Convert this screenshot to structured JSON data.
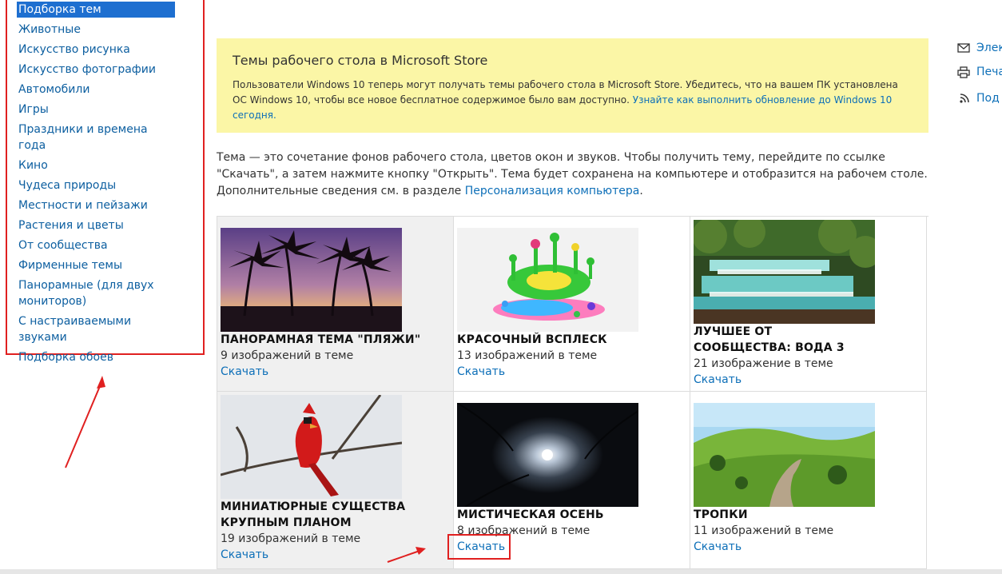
{
  "sidebar": {
    "items": [
      {
        "label": "Подборка тем",
        "active": true
      },
      {
        "label": "Животные"
      },
      {
        "label": "Искусство рисунка"
      },
      {
        "label": "Искусство фотографии"
      },
      {
        "label": "Автомобили"
      },
      {
        "label": "Игры"
      },
      {
        "label": "Праздники и времена года"
      },
      {
        "label": "Кино"
      },
      {
        "label": "Чудеса природы"
      },
      {
        "label": "Местности и пейзажи"
      },
      {
        "label": "Растения и цветы"
      },
      {
        "label": "От сообщества"
      },
      {
        "label": "Фирменные темы"
      },
      {
        "label": "Панорамные (для двух мониторов)"
      },
      {
        "label": "С настраиваемыми звуками"
      },
      {
        "label": "Подборка обоев"
      }
    ]
  },
  "banner": {
    "title": "Темы рабочего стола в Microsoft Store",
    "text": "Пользователи Windows 10 теперь могут получать темы рабочего стола в Microsoft Store. Убедитесь, что на вашем ПК установлена ОС Windows 10, чтобы все новое бесплатное содержимое было вам доступно.",
    "link": "Узнайте как выполнить обновление до Windows 10 сегодня."
  },
  "intro": {
    "text": "Тема — это сочетание фонов рабочего стола, цветов окон и звуков. Чтобы получить тему, перейдите по ссылке \"Скачать\", а затем нажмите кнопку \"Открыть\". Тема будет сохранена на компьютере и отобразится на рабочем столе. Дополнительные сведения см. в разделе",
    "link": "Персонализация компьютера",
    "tail": "."
  },
  "themes": [
    {
      "title": "ПАНОРАМНАЯ ТЕМА \"ПЛЯЖИ\"",
      "count": "9 изображений в теме",
      "link": "Скачать"
    },
    {
      "title": "КРАСОЧНЫЙ ВСПЛЕСК",
      "count": "13 изображений в теме",
      "link": "Скачать"
    },
    {
      "title": "ЛУЧШЕЕ ОТ СООБЩЕСТВА: ВОДА 3",
      "count": "21 изображение в теме",
      "link": "Скачать"
    },
    {
      "title": "МИНИАТЮРНЫЕ СУЩЕСТВА КРУПНЫМ ПЛАНОМ",
      "count": "19 изображений в теме",
      "link": "Скачать"
    },
    {
      "title": "МИСТИЧЕСКАЯ ОСЕНЬ",
      "count": "8 изображений в теме",
      "link": "Скачать"
    },
    {
      "title": "ТРОПКИ",
      "count": "11 изображений в теме",
      "link": "Скачать"
    }
  ],
  "tools": {
    "email": "Элек",
    "print": "Печа",
    "subscribe": "Под"
  },
  "colors": {
    "link": "#0d6fb8",
    "banner_bg": "#fbf6a6",
    "active_bg": "#1e6fd0",
    "annotation_red": "#e02020"
  }
}
